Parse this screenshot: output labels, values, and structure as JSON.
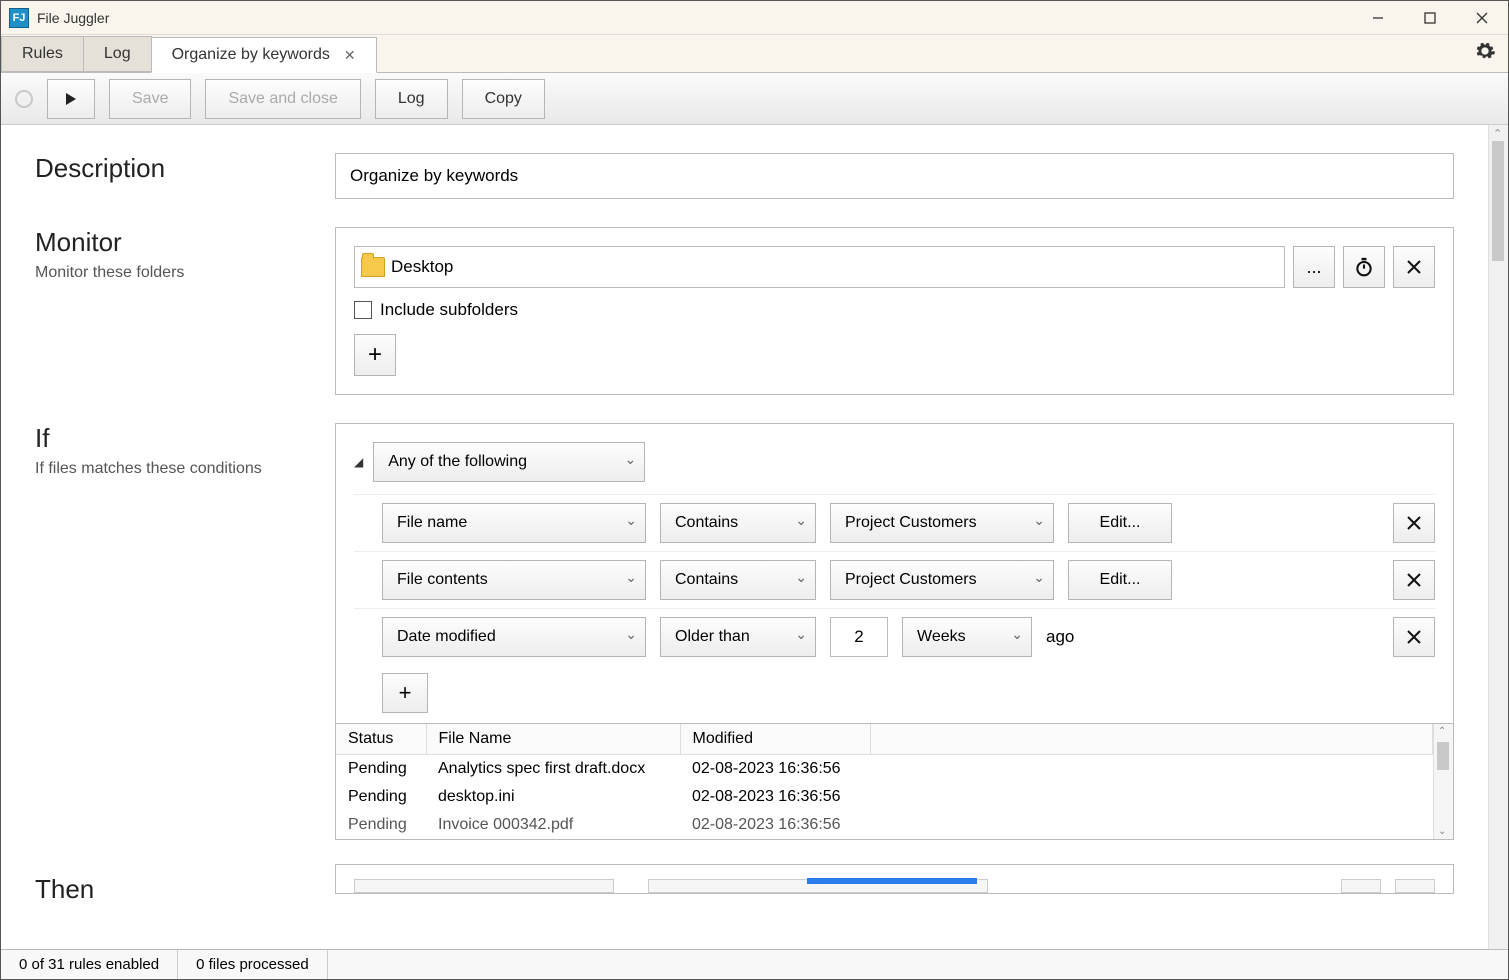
{
  "app": {
    "title": "File Juggler",
    "icon_label": "FJ"
  },
  "tabs": {
    "rules": "Rules",
    "log": "Log",
    "active": "Organize by keywords"
  },
  "toolbar": {
    "save": "Save",
    "save_close": "Save and close",
    "log": "Log",
    "copy": "Copy"
  },
  "sections": {
    "description_label": "Description",
    "description_value": "Organize by keywords",
    "monitor_label": "Monitor",
    "monitor_sub": "Monitor these folders",
    "monitor_folder": "Desktop",
    "include_subfolders": "Include subfolders",
    "browse": "...",
    "if_label": "If",
    "if_sub": "If files matches these conditions",
    "match_mode": "Any of the following",
    "then_label": "Then"
  },
  "conditions": [
    {
      "field": "File name",
      "op": "Contains",
      "value": "Project Customers",
      "edit": "Edit...",
      "type": "text"
    },
    {
      "field": "File contents",
      "op": "Contains",
      "value": "Project Customers",
      "edit": "Edit...",
      "type": "text"
    },
    {
      "field": "Date modified",
      "op": "Older than",
      "num": "2",
      "unit": "Weeks",
      "suffix": "ago",
      "type": "date"
    }
  ],
  "matches": {
    "cols": {
      "status": "Status",
      "name": "File Name",
      "modified": "Modified"
    },
    "rows": [
      {
        "status": "Pending",
        "name": "Analytics spec first draft.docx",
        "modified": "02-08-2023 16:36:56"
      },
      {
        "status": "Pending",
        "name": "desktop.ini",
        "modified": "02-08-2023 16:36:56"
      },
      {
        "status": "Pending",
        "name": "Invoice 000342.pdf",
        "modified": "02-08-2023 16:36:56"
      }
    ]
  },
  "status": {
    "rules": "0 of 31 rules enabled",
    "files": "0 files processed"
  }
}
